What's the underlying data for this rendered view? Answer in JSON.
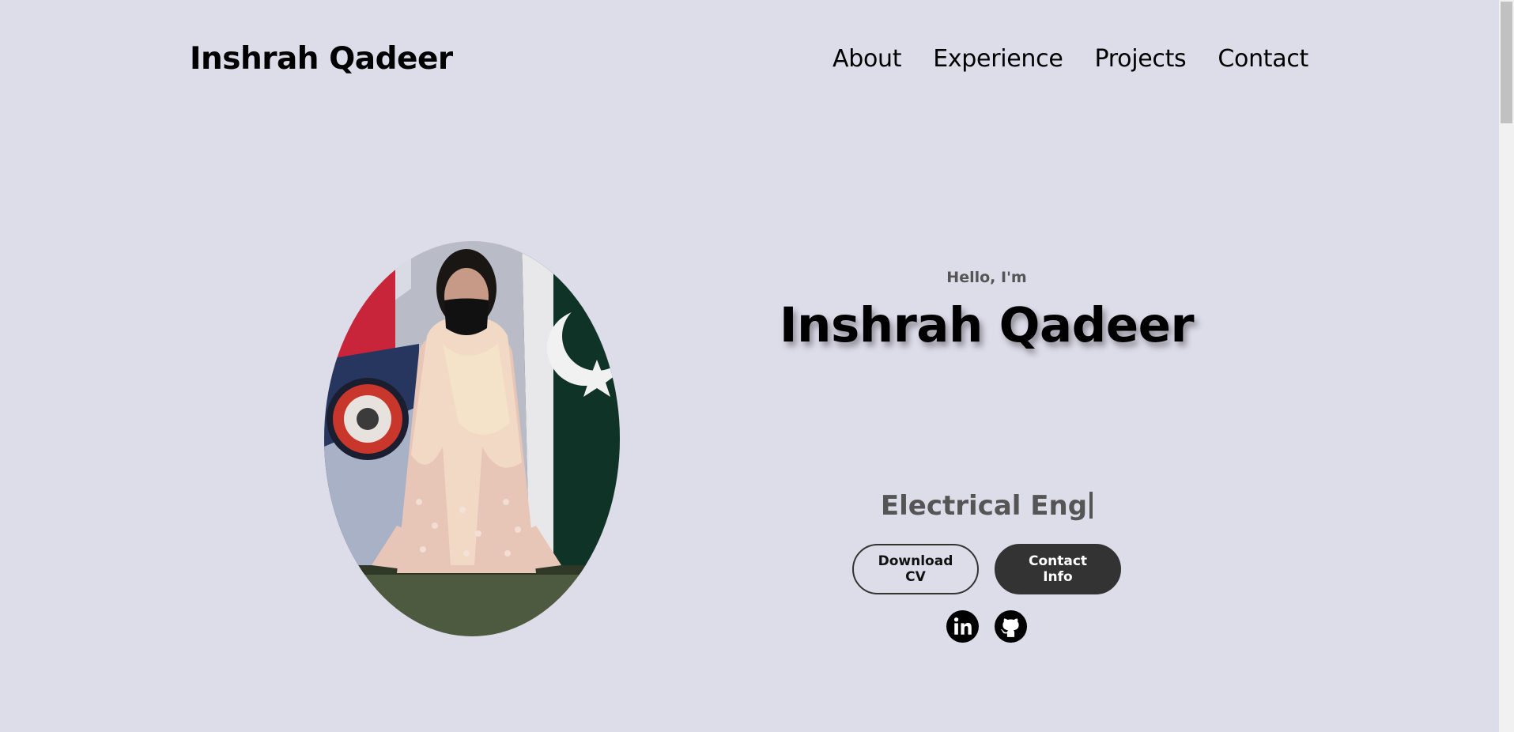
{
  "header": {
    "brand": "Inshrah Qadeer",
    "nav": [
      {
        "label": "About"
      },
      {
        "label": "Experience"
      },
      {
        "label": "Projects"
      },
      {
        "label": "Contact"
      }
    ]
  },
  "hero": {
    "greeting": "Hello, I'm",
    "name": "Inshrah Qadeer",
    "role_typed": "Electrical Eng",
    "buttons": {
      "download_cv": "Download CV",
      "contact_info": "Contact Info"
    },
    "social_icons": [
      "linkedin-icon",
      "github-icon"
    ],
    "portrait_alt": "profile-photo"
  },
  "colors": {
    "background": "#dddce9",
    "button_dark": "#333333",
    "muted_text": "#555555"
  }
}
